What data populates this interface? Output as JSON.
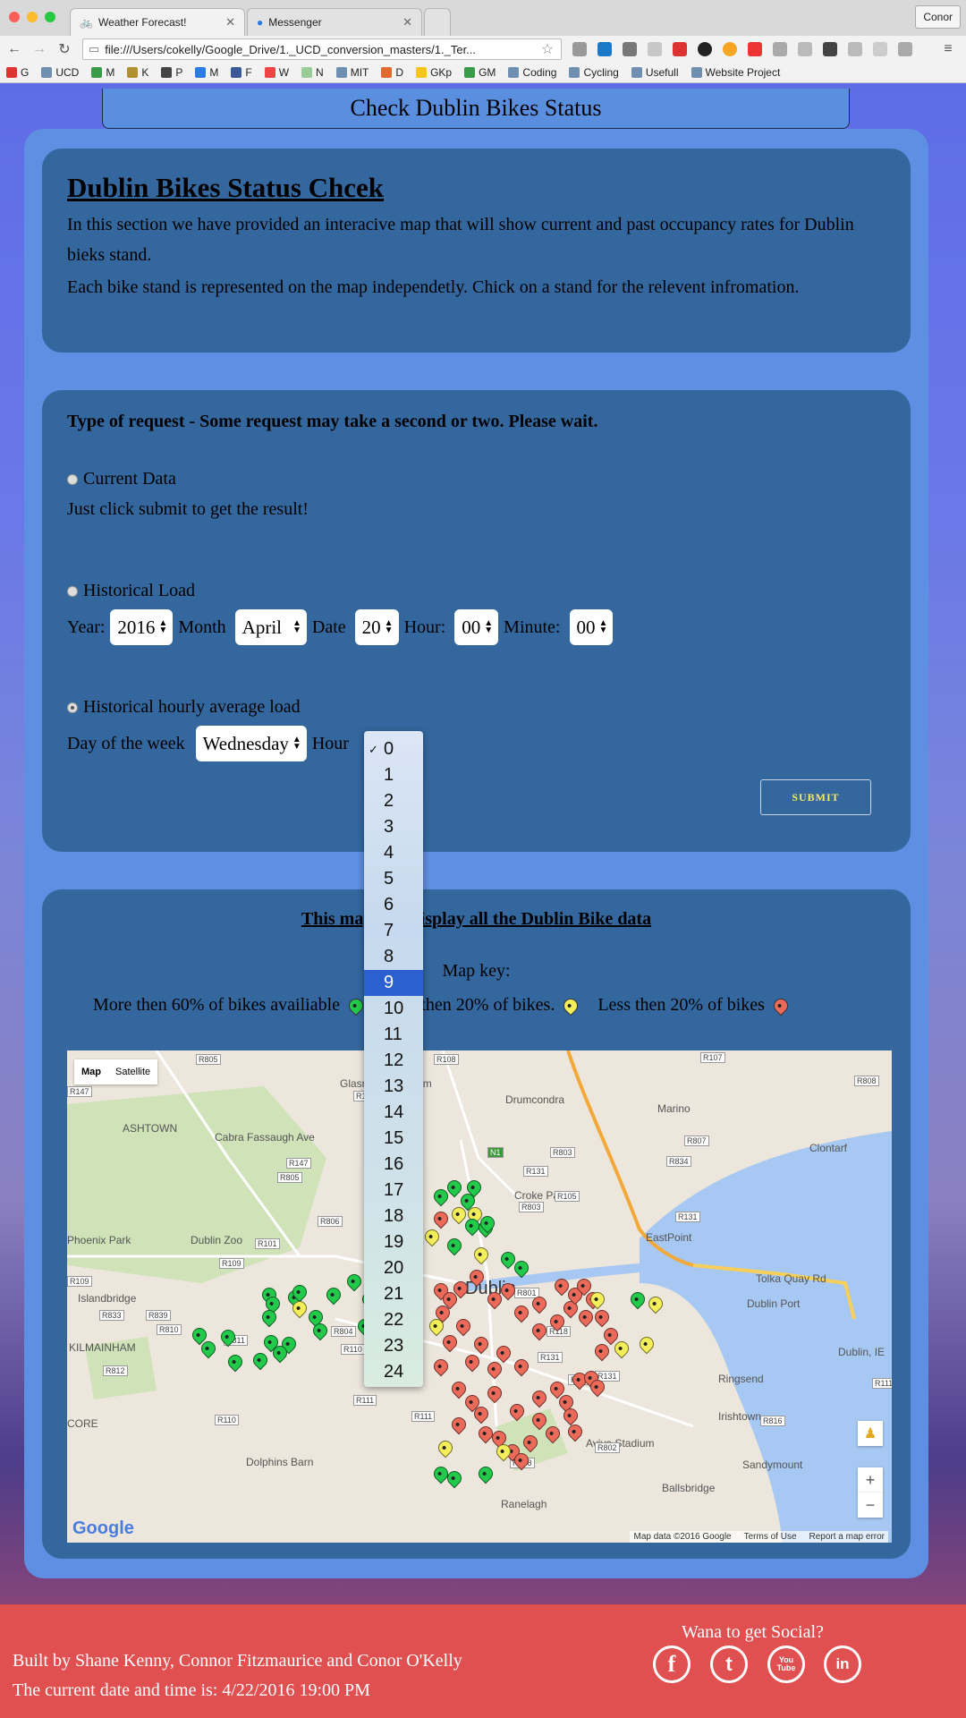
{
  "browser": {
    "tabs": [
      {
        "title": "Weather Forecast!",
        "active": true
      },
      {
        "title": "Messenger",
        "active": false
      }
    ],
    "profile": "Conor",
    "url": "file:///Users/cokelly/Google_Drive/1._UCD_conversion_masters/1._Ter...",
    "bookmarks": [
      "G",
      "UCD",
      "M",
      "K",
      "P",
      "M",
      "F",
      "W",
      "N",
      "MIT",
      "D",
      "GKp",
      "GM",
      "Coding",
      "Cycling",
      "Usefull",
      "Website Project"
    ]
  },
  "header": {
    "title": "Check Dublin Bikes Status"
  },
  "intro": {
    "heading": "Dublin Bikes Status Chcek",
    "para1": "In this section we have provided an interacive map that will show current and past occupancy rates for Dublin bieks stand.",
    "para2": "Each bike stand is represented on the map independetly. Chick on a stand for the relevent infromation."
  },
  "form": {
    "heading": "Type of request - Some request may take a second or two. Please wait.",
    "current": {
      "label": "Current Data",
      "hint": "Just click submit to get the result!"
    },
    "historical": {
      "label": "Historical Load",
      "year_label": "Year:",
      "year": "2016",
      "month_label": "Month",
      "month": "April",
      "date_label": "Date",
      "date": "20",
      "hour_label": "Hour:",
      "hour": "00",
      "minute_label": "Minute:",
      "minute": "00"
    },
    "hourly": {
      "label": "Historical hourly average load",
      "day_label": "Day of the week",
      "day": "Wednesday",
      "hour_label": "Hour"
    },
    "submit": "SUBMIT",
    "selected_radio": "hourly"
  },
  "map_section": {
    "title": "This map will display all the Dublin Bike data",
    "key_title": "Map key:",
    "legend_green": "More then 60% of bikes availiable",
    "legend_yellow": "More then 20% of bikes.",
    "legend_red": "Less then 20% of bikes",
    "colors": {
      "green": "#22c94a",
      "yellow": "#f4ee5a",
      "red": "#ec6a5a"
    }
  },
  "map": {
    "type_map": "Map",
    "type_satellite": "Satellite",
    "labels": [
      "Glasnevin Museum",
      "Drumcondra",
      "Marino",
      "Clontarf",
      "Cabra Fassaugh Ave",
      "ASHTOWN",
      "Dublin Zoo",
      "Phoenix Park",
      "Islandbridge",
      "KILMAINHAM",
      "Dolphins Barn",
      "Ringsend",
      "Irishtown",
      "Sandymount",
      "Ballsbridge",
      "Ranelagh",
      "Aviva Stadium",
      "EastPoint",
      "Tolka Quay Rd",
      "Dublin Port",
      "Dublin, IE",
      "Croke Park",
      "CORE",
      "Dublin"
    ],
    "roads": [
      "R805",
      "R108",
      "R107",
      "R808",
      "R147",
      "R135",
      "R803",
      "R807",
      "R834",
      "R147",
      "R805",
      "R131",
      "R105",
      "R803",
      "R131",
      "R806",
      "R101",
      "R109",
      "R109",
      "R833",
      "R839",
      "R810",
      "R811",
      "R804",
      "R110",
      "R137",
      "R812",
      "R110",
      "R111",
      "R111",
      "R131",
      "R816",
      "R802",
      "R111",
      "R138",
      "R801",
      "R118",
      "R131",
      "R815",
      "N1"
    ],
    "zoom_in": "+",
    "zoom_out": "−",
    "attribution": "Map data ©2016 Google",
    "terms": "Terms of Use",
    "report": "Report a map error",
    "logo": "Google"
  },
  "dropdown": {
    "options": [
      "0",
      "1",
      "2",
      "3",
      "4",
      "5",
      "6",
      "7",
      "8",
      "9",
      "10",
      "11",
      "12",
      "13",
      "14",
      "15",
      "16",
      "17",
      "18",
      "19",
      "20",
      "21",
      "22",
      "23",
      "24"
    ],
    "checked": "0",
    "highlighted": "9"
  },
  "footer": {
    "built_by": "Built by Shane Kenny, Connor Fitzmaurice and Conor O'Kelly",
    "datetime": "The current date and time is: 4/22/2016 19:00 PM",
    "social_title": "Wana to get Social?",
    "social": [
      {
        "name": "facebook",
        "glyph": "f"
      },
      {
        "name": "twitter",
        "glyph": "t"
      },
      {
        "name": "youtube",
        "glyph": "You Tube"
      },
      {
        "name": "linkedin",
        "glyph": "in"
      }
    ]
  }
}
